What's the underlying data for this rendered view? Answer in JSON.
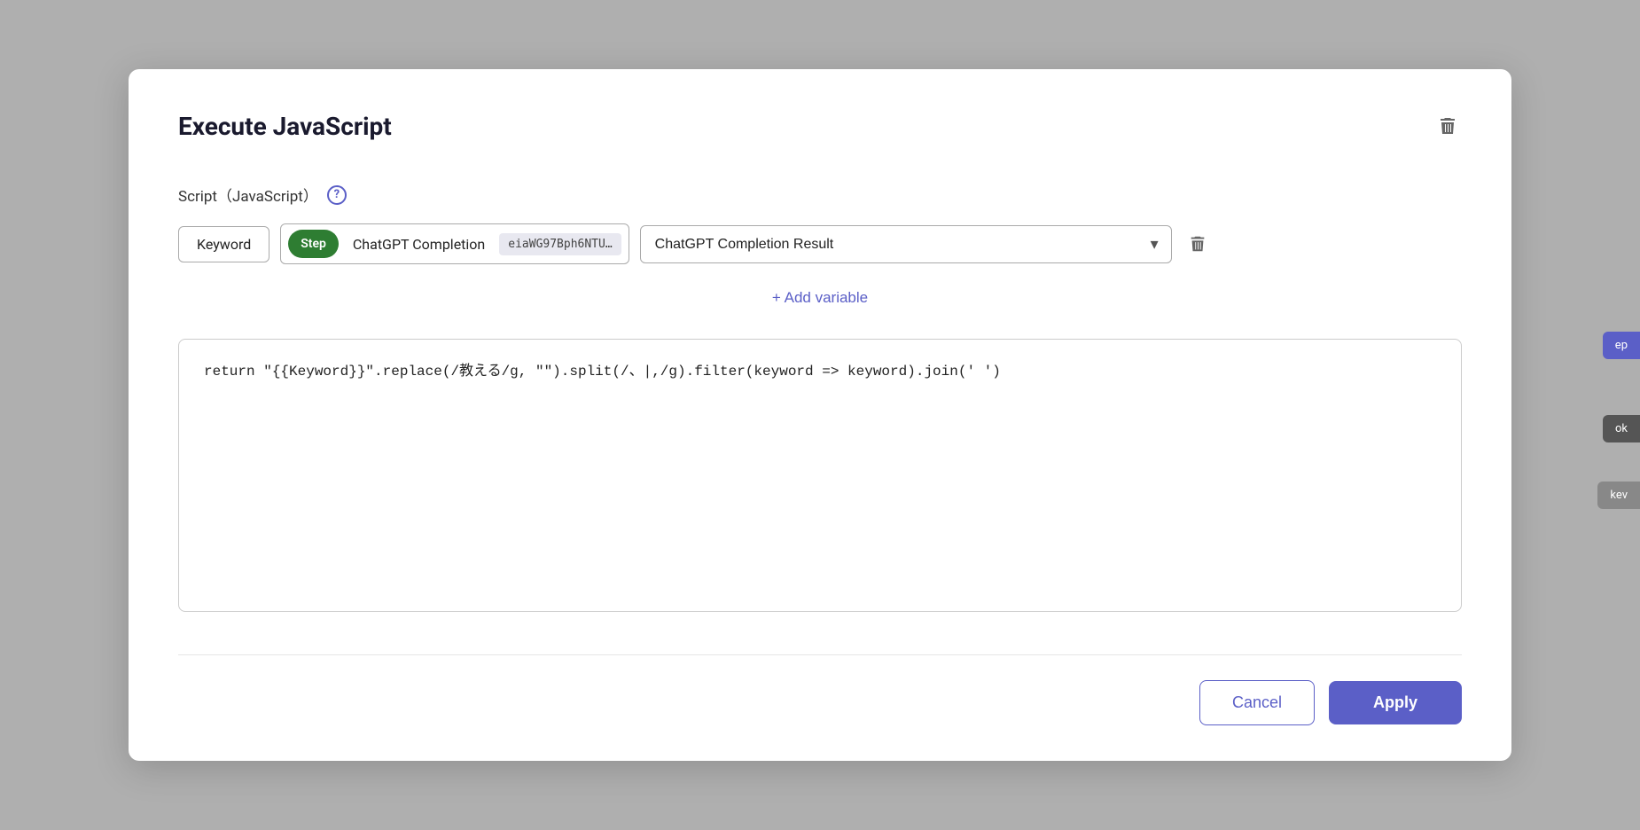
{
  "modal": {
    "title": "Execute JavaScript",
    "section_label": "Script（JavaScript）",
    "help_icon_label": "?",
    "variable_row": {
      "keyword_label": "Keyword",
      "step_badge": "Step",
      "step_name": "ChatGPT Completion",
      "step_id": "eiaWG97Bph6NTU…",
      "result_options": [
        "ChatGPT Completion Result"
      ],
      "result_selected": "ChatGPT Completion Result"
    },
    "add_variable_label": "+ Add variable",
    "code_value": "return \"{{Keyword}}\".replace(/教える/g, \"\").split(/、|,/g).filter(keyword => keyword).join(' ')",
    "footer": {
      "cancel_label": "Cancel",
      "apply_label": "Apply"
    }
  },
  "icons": {
    "trash": "🗑",
    "help": "?",
    "chevron_down": "▾",
    "plus": "+"
  },
  "peek": {
    "left_label": "",
    "right_step_label": "ep",
    "right_ok_label": "ok",
    "right_kev_label": "kev"
  }
}
